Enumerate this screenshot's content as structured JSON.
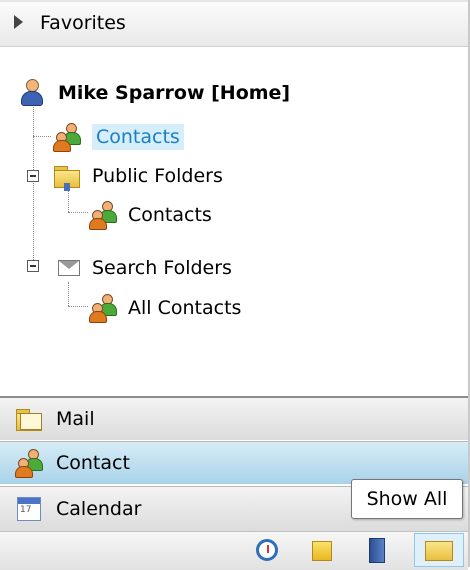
{
  "favorites": {
    "label": "Favorites",
    "icon": "triangle-right-icon"
  },
  "tree": {
    "root": {
      "label": "Mike Sparrow [Home]",
      "icon": "person-icon"
    },
    "contacts": {
      "label": "Contacts",
      "icon": "contacts-icon",
      "selected": true
    },
    "public_folders": {
      "label": "Public Folders",
      "icon": "public-folder-icon"
    },
    "public_contacts": {
      "label": "Contacts",
      "icon": "contacts-icon"
    },
    "search_folders": {
      "label": "Search Folders",
      "icon": "search-folder-icon"
    },
    "all_contacts": {
      "label": "All Contacts",
      "icon": "contacts-icon"
    }
  },
  "nav": {
    "mail": {
      "label": "Mail",
      "icon": "mail-folder-icon"
    },
    "contact": {
      "label": "Contact",
      "icon": "contacts-icon",
      "active": true
    },
    "calendar": {
      "label": "Calendar",
      "icon": "calendar-icon",
      "day": "17"
    }
  },
  "toolbar": {
    "buttons": [
      "clock-icon",
      "notes-icon",
      "journal-icon",
      "folder-icon"
    ]
  },
  "tooltip": {
    "text": "Show All"
  },
  "colors": {
    "selection_bg": "#d6eefa",
    "selection_text": "#1b7fc4",
    "active_bar": "#a9d3ea"
  }
}
